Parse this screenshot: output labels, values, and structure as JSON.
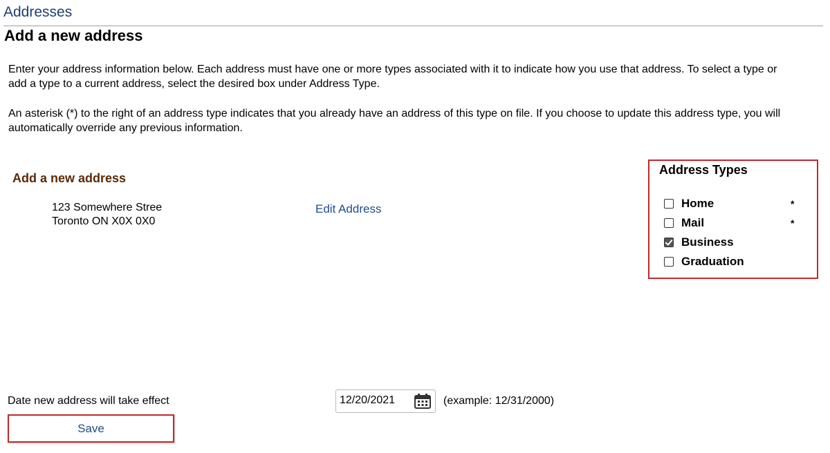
{
  "header": {
    "breadcrumb": "Addresses",
    "title": "Add a new address"
  },
  "instructions": {
    "paragraph1": "Enter your address information below. Each address must have one or more types associated with it to indicate how you use that address. To select a type or add a type to a current address, select the desired box under Address Type.",
    "paragraph2": "An asterisk (*) to the right of an address type indicates that you already have an address of this type on file.  If you choose to update this address type, you will automatically override any previous information."
  },
  "address_section": {
    "heading": "Add a new address",
    "line1": "123 Somewhere Stree",
    "line2": "Toronto ON X0X 0X0",
    "edit_label": "Edit Address"
  },
  "address_types": {
    "title": "Address Types",
    "items": [
      {
        "label": "Home",
        "checked": false,
        "marker": "*"
      },
      {
        "label": "Mail",
        "checked": false,
        "marker": "*"
      },
      {
        "label": "Business",
        "checked": true,
        "marker": ""
      },
      {
        "label": "Graduation",
        "checked": false,
        "marker": ""
      }
    ]
  },
  "effective_date": {
    "label": "Date new address will take effect",
    "value": "12/20/2021",
    "example": "(example: 12/31/2000)",
    "icon": "calendar-icon"
  },
  "actions": {
    "save_label": "Save"
  },
  "colors": {
    "title_blue": "#1d3f73",
    "link_blue": "#1d4e89",
    "heading_brown": "#5b2a06",
    "highlight_red": "#c0282d"
  }
}
